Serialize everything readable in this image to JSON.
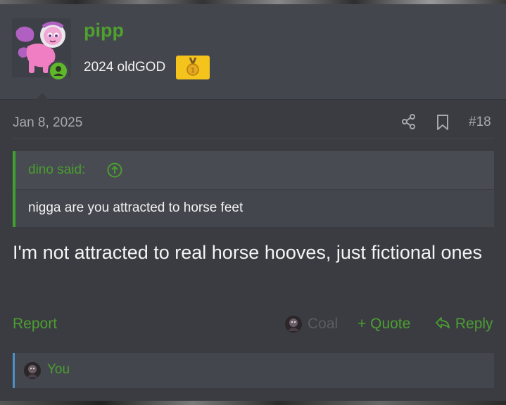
{
  "user": {
    "name": "pipp",
    "title": "2024 oldGOD",
    "status": "online"
  },
  "post": {
    "date": "Jan 8, 2025",
    "number": "#18",
    "body": "I'm not attracted to real horse hooves, just fictional ones"
  },
  "quote": {
    "author": "dino said:",
    "text": "nigga are you attracted to horse feet"
  },
  "actions": {
    "report": "Report",
    "coal": "Coal",
    "quote": "Quote",
    "reply": "Reply"
  },
  "reactions": {
    "label": "You"
  },
  "colors": {
    "accent_green": "#4d9e31",
    "online_green": "#5fb82a",
    "medal_gold": "#f4c31c",
    "quote_border": "#3fa22c",
    "reacts_border": "#4e90c9"
  },
  "icons": {
    "share": "share-icon",
    "bookmark": "bookmark-icon",
    "quote_jump": "arrow-up-circle-icon",
    "quote_action": "plus-icon",
    "reply_action": "reply-arrow-icon"
  }
}
